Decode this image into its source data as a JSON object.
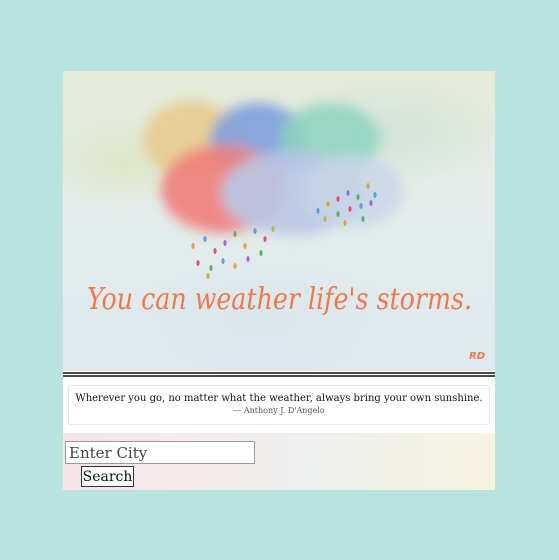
{
  "hero": {
    "handwritten_text": "You can weather life's storms.",
    "signature": "RD"
  },
  "quote": {
    "text": "Wherever you go, no matter what the weather, always bring your own sunshine.",
    "author": "— Anthony J. D'Angelo"
  },
  "search": {
    "placeholder": "Enter City",
    "button_label": "Search"
  },
  "colors": {
    "page_background": "#b9e3de",
    "lettering": "#ee7a4c"
  }
}
